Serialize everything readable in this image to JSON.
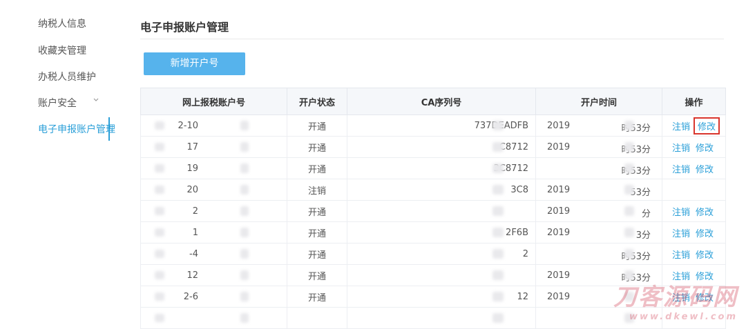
{
  "sidebar": {
    "items": [
      {
        "label": "纳税人信息"
      },
      {
        "label": "收藏夹管理"
      },
      {
        "label": "办税人员维护"
      },
      {
        "label": "账户安全"
      },
      {
        "label": "电子申报账户管理"
      }
    ],
    "active_index": 4,
    "active_color": "#2a9fd8"
  },
  "main": {
    "title": "电子申报账户管理",
    "add_button_label": "新增开户号",
    "button_color": "#56b3ec"
  },
  "table": {
    "headers": [
      "网上报税账户号",
      "开户状态",
      "CA序列号",
      "开户时间",
      "操作"
    ],
    "rows": [
      {
        "account": "2-10",
        "status": "开通",
        "ca": "737DEADFB",
        "year": "2019",
        "time": "时53分",
        "ops": [
          "注销",
          "修改"
        ],
        "highlight": true
      },
      {
        "account": "17",
        "status": "开通",
        "ca": "C8712",
        "year": "2019",
        "time": "时53分",
        "ops": [
          "注销",
          "修改"
        ]
      },
      {
        "account": "19",
        "status": "开通",
        "ca": "3C8712",
        "year": "",
        "time": "时53分",
        "ops": [
          "注销",
          "修改"
        ]
      },
      {
        "account": "20",
        "status": "注销",
        "ca": "3C8",
        "year": "2019",
        "time": "53分",
        "ops": []
      },
      {
        "account": "2",
        "status": "开通",
        "ca": "",
        "year": "2019",
        "time": "分",
        "ops": [
          "注销",
          "修改"
        ]
      },
      {
        "account": "1",
        "status": "开通",
        "ca": "2F6B",
        "year": "2019",
        "time": "3分",
        "ops": [
          "注销",
          "修改"
        ]
      },
      {
        "account": "-4",
        "status": "开通",
        "ca": "2",
        "year": "",
        "time": "时53分",
        "ops": [
          "注销",
          "修改"
        ]
      },
      {
        "account": "12",
        "status": "开通",
        "ca": "",
        "year": "2019",
        "time": "时53分",
        "ops": [
          "注销",
          "修改"
        ]
      },
      {
        "account": "2-6",
        "status": "开通",
        "ca": "12",
        "year": "2019",
        "time": "",
        "ops": [
          "注销",
          "修改"
        ]
      },
      {
        "account": "",
        "status": "",
        "ca": "",
        "year": "",
        "time": "",
        "ops": []
      }
    ]
  },
  "watermark": {
    "line1": "刀客源码网",
    "line2": "www.dkewl.com"
  }
}
